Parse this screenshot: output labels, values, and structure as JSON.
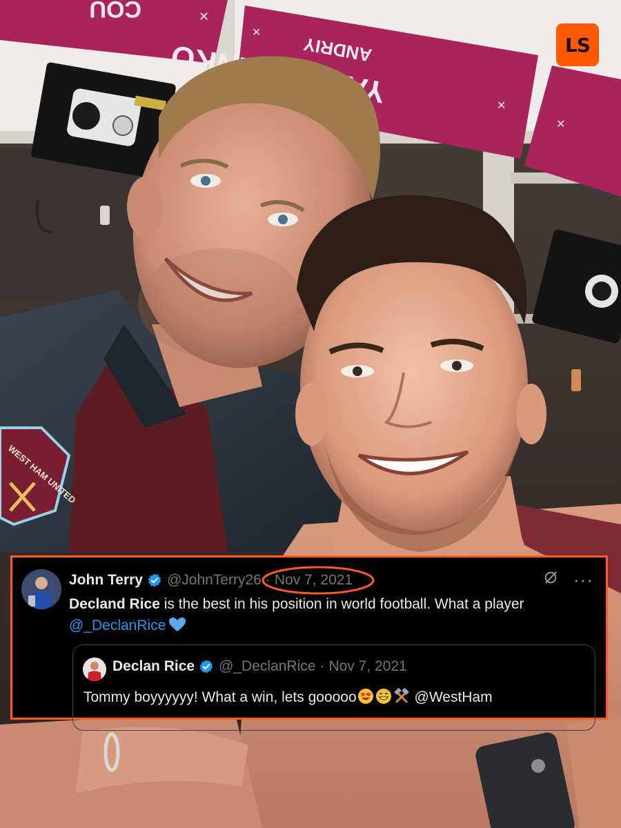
{
  "badge": {
    "logo_text": "LS"
  },
  "photo": {
    "nameplate_first": "ANDRIY",
    "nameplate_last": "YARMOLENKO",
    "nameplate_partial": "COU",
    "crest_text": "WEST HAM UNITED"
  },
  "tweet": {
    "author_name": "John Terry",
    "author_handle": "@JohnTerry26",
    "separator": "·",
    "date": "Nov 7, 2021",
    "bold_text": "Decland Rice",
    "text": " is the best in his position in world football. What a player",
    "mention": "@_DeclanRice",
    "icons": [
      "verified-badge-icon",
      "share-icon",
      "more-icon",
      "blue-heart-icon"
    ]
  },
  "quoted": {
    "author_name": "Declan Rice",
    "author_handle": "@_DeclanRice",
    "separator": "·",
    "date": "Nov 7, 2021",
    "text": "Tommy boyyyyyy! What a win, lets gooooo",
    "mention": "@WestHam",
    "icons": [
      "heart-eyes-emoji",
      "grin-emoji",
      "hammers-emoji"
    ]
  },
  "colors": {
    "accent": "#ff5a1f",
    "verified": "#1d9bf0",
    "claret": "#a8245a",
    "card_bg": "#000000"
  }
}
